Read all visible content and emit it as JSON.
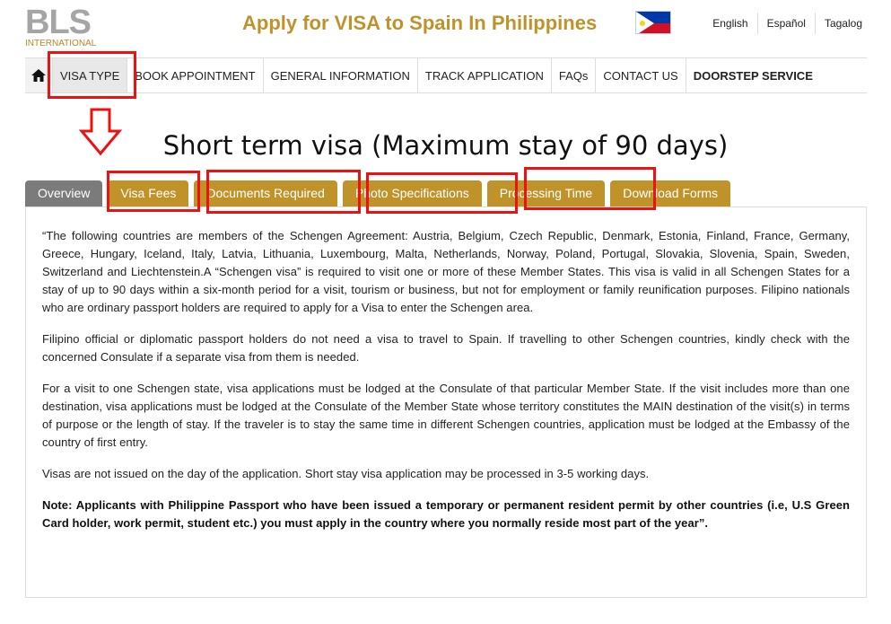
{
  "header": {
    "logo_main": "BLS",
    "logo_sub": "INTERNATIONAL",
    "title": "Apply for VISA to Spain In Philippines",
    "languages": [
      "English",
      "Español",
      "Tagalog"
    ]
  },
  "nav": {
    "home_icon": "home-icon",
    "items": [
      "VISA TYPE",
      "BOOK APPOINTMENT",
      "GENERAL INFORMATION",
      "TRACK APPLICATION",
      "FAQs",
      "CONTACT US",
      "DOORSTEP SERVICE"
    ]
  },
  "page_title": "Short term visa (Maximum stay of 90 days)",
  "tabs": [
    "Overview",
    "Visa Fees",
    "Documents Required",
    "Photo Specifications",
    "Processing Time",
    "Download Forms"
  ],
  "content": {
    "paragraphs": [
      "“The following countries are members of the Schengen Agreement: Austria, Belgium, Czech Republic, Denmark, Estonia, Finland, France, Germany, Greece, Hungary, Iceland, Italy, Latvia, Lithuania, Luxembourg, Malta, Netherlands, Norway, Poland, Portugal, Slovakia, Slovenia, Spain, Sweden, Switzerland and Liechtenstein.A “Schengen visa” is required to visit one or more of these Member States. This visa is valid in all Schengen States for a stay of up to 90 days within a six-month period for a visit, tourism or business, but not for employment or family reunification purposes. Filipino nationals who are ordinary passport holders are required to apply for a Visa to enter the Schengen area.",
      "Filipino official or diplomatic passport holders do not need a visa to travel to Spain. If travelling to other Schengen countries, kindly check with the concerned Consulate if a separate visa from them is needed.",
      "For a visit to one Schengen state, visa applications must be lodged at the Consulate of that particular Member State. If the visit includes more than one destination, visa applications must be lodged at the Consulate of the Member State whose territory constitutes the MAIN destination of the visit(s) in terms of purpose or the length of stay. If the traveler is to stay the same time in different Schengen countries, application must be lodged at the Embassy of the country of first entry.",
      "Visas are not issued on the day of the application. Short stay visa application may be processed in 3-5 working days."
    ],
    "note": "Note: Applicants with Philippine Passport who have been issued a temporary or permanent resident permit by other countries (i.e, U.S Green Card holder, work permit, student etc.) you must apply in the country where you normally reside most part of the year”."
  },
  "colors": {
    "accent_gold": "#bf922a",
    "active_tab": "#7b7b7b",
    "annotation_red": "#e11111"
  }
}
